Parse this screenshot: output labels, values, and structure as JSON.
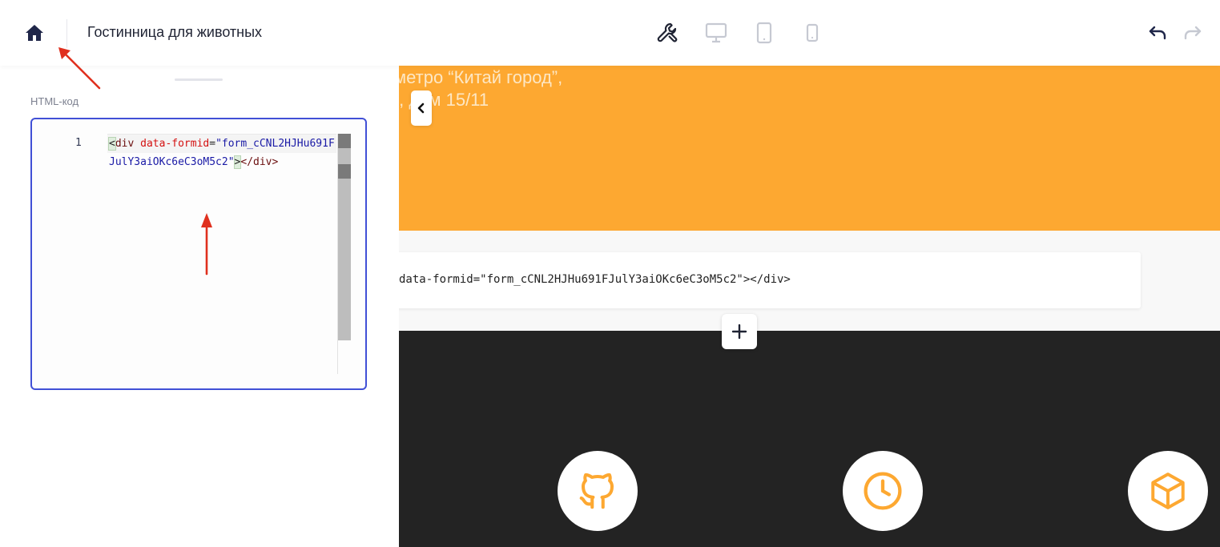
{
  "topbar": {
    "title": "Гостинница для животных",
    "icons": {
      "home": "home-icon",
      "tools": "wrench-icon",
      "desktop": "desktop-icon",
      "tablet": "tablet-icon",
      "mobile": "mobile-icon",
      "undo": "undo-icon",
      "redo": "redo-icon"
    }
  },
  "left_panel": {
    "field_label": "HTML-код",
    "editor": {
      "line_number": "1",
      "code_tag_open": "<div",
      "code_attr": "data-formid",
      "code_eq": "=",
      "code_value": "\"form_cCNL2HJHu691FJulY3aiOKc6eC3oM5c2\"",
      "code_close_bracket": ">",
      "code_tag_close": "</div>"
    }
  },
  "preview": {
    "address_line1": "метро “Китай город”,",
    "address_line2": "., дом 15/11",
    "code_card_text": "data-formid=\"form_cCNL2HJHu691FJulY3aiOKc6eC3oM5c2\"></div>",
    "accent_color": "#fda831",
    "dark_color": "#232323",
    "feature_icons": [
      "github-icon",
      "clock-icon",
      "box-icon"
    ]
  },
  "colors": {
    "editor_border": "#4150d6",
    "annotation_arrow": "#e0301e"
  }
}
